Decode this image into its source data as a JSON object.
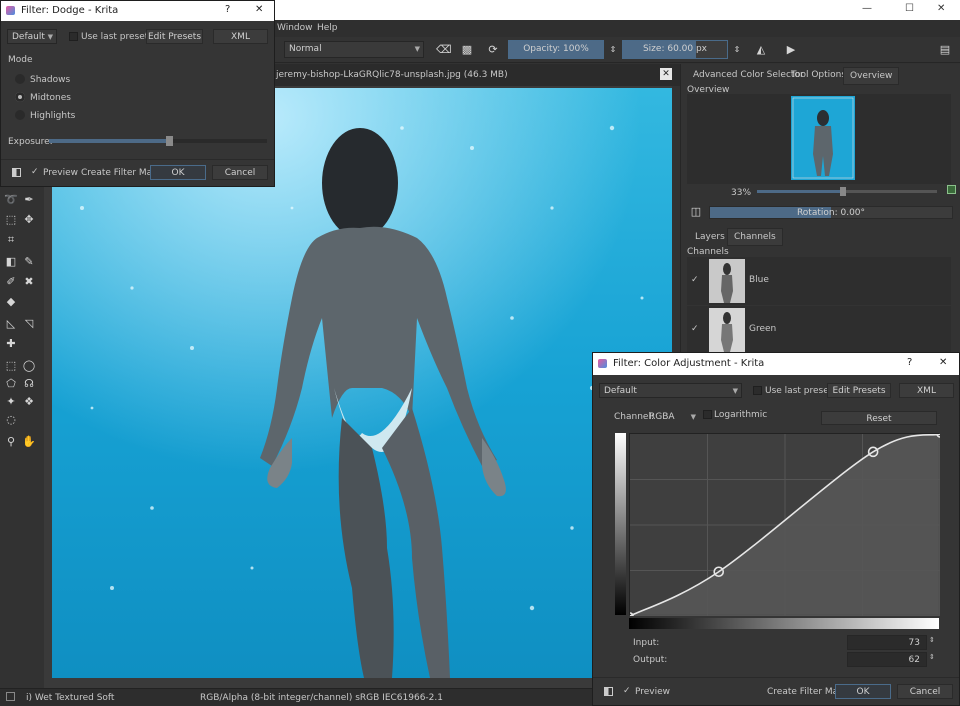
{
  "main_window": {
    "title_buttons": [
      "—",
      "☐",
      "✕"
    ],
    "menu": [
      "Window",
      "Help"
    ]
  },
  "toolbar": {
    "blend_mode": "Normal",
    "opacity_label": "Opacity: 100%",
    "size_label": "Size: 60.00 px"
  },
  "document": {
    "tab_title": "jeremy-bishop-LkaGRQlic78-unsplash.jpg (46.3 MB)"
  },
  "docker": {
    "tabs": [
      "Advanced Color Selector",
      "Tool Options",
      "Overview"
    ],
    "overview_title": "Overview",
    "zoom": "33%",
    "zoom_fraction": 0.48,
    "rotation_label": "Rotation: 0.00°",
    "layer_tabs": [
      "Layers",
      "Channels"
    ],
    "channels_title": "Channels",
    "channels": [
      {
        "name": "Blue",
        "checked": "✓"
      },
      {
        "name": "Green",
        "checked": "✓"
      }
    ]
  },
  "status_bar": {
    "brush": "i) Wet Textured Soft",
    "color_info": "RGB/Alpha (8-bit integer/channel)  sRGB IEC61966-2.1"
  },
  "dodge_dialog": {
    "title": "Filter: Dodge - Krita",
    "help": "?",
    "close": "✕",
    "preset": "Default",
    "use_last_preset": "Use last preset",
    "edit_presets": "Edit Presets",
    "xml": "XML",
    "mode_label": "Mode",
    "modes": [
      "Shadows",
      "Midtones",
      "Highlights"
    ],
    "exposure_label": "Exposure:",
    "exposure_fraction": 0.55,
    "preview": "Preview",
    "preview_check": "✓",
    "create_filter_mask": "Create Filter Mask",
    "ok": "OK",
    "cancel": "Cancel"
  },
  "color_dialog": {
    "title": "Filter: Color Adjustment - Krita",
    "help": "?",
    "close": "✕",
    "preset": "Default",
    "use_last_preset": "Use last preset",
    "edit_presets": "Edit Presets",
    "xml": "XML",
    "channel_label": "Channel:",
    "channel_value": "RGBA",
    "logarithmic": "Logarithmic",
    "reset": "Reset",
    "input_label": "Input:",
    "input_value": "73",
    "output_label": "Output:",
    "output_value": "62",
    "preview": "Preview",
    "preview_check": "✓",
    "create_filter_mask": "Create Filter Mask",
    "ok": "OK",
    "cancel": "Cancel"
  },
  "curve": {
    "points": [
      [
        0,
        0
      ],
      [
        73,
        62
      ],
      [
        200,
        230
      ],
      [
        255,
        255
      ]
    ]
  },
  "colors": {
    "accent": "#4a6b8a",
    "water": "#1aa3d6"
  }
}
